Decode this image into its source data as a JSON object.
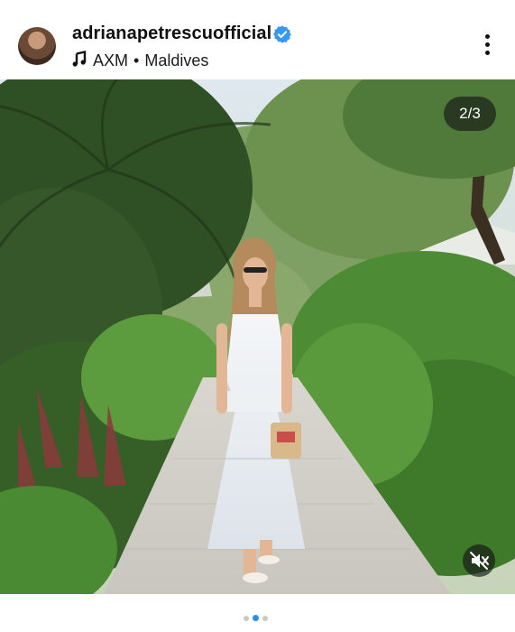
{
  "post": {
    "username": "adrianapetrescuofficial",
    "audio": "AXM",
    "separator": "•",
    "location": "Maldives",
    "image_counter": "2/3",
    "carousel": {
      "total": 3,
      "active_index": 1
    }
  },
  "colors": {
    "verified_badge": "#3897f0",
    "active_dot": "#2c8ee8",
    "inactive_dot": "#c9c9c9"
  },
  "icons": [
    "verified-badge-icon",
    "music-note-icon",
    "more-options-icon",
    "mute-icon"
  ]
}
